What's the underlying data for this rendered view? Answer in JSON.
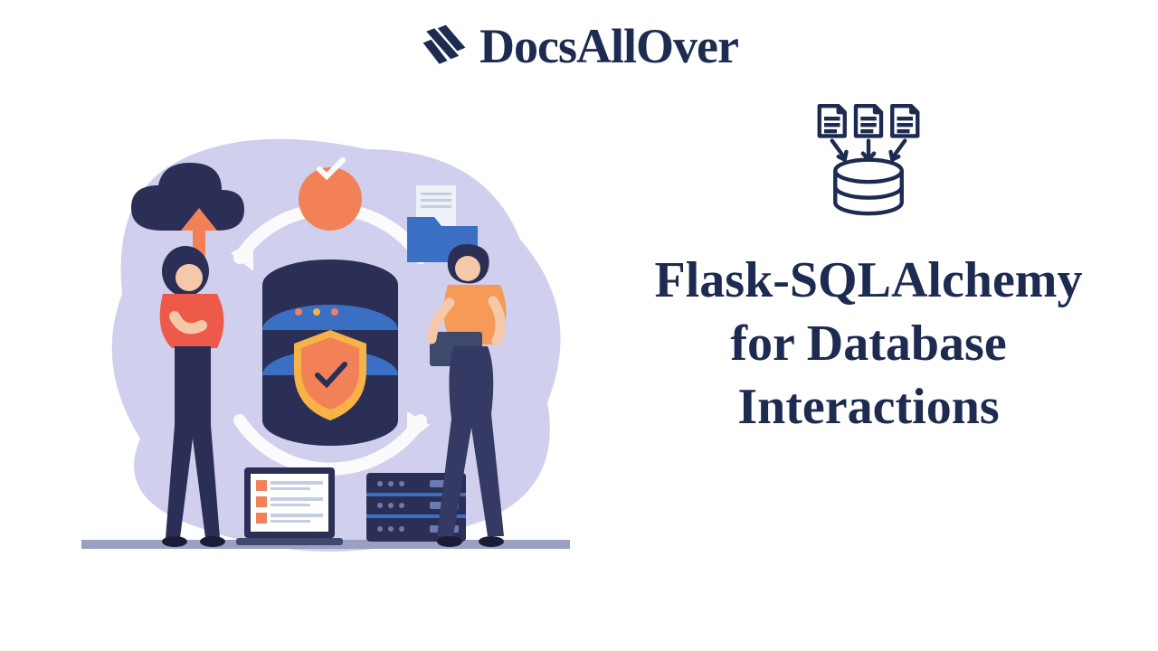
{
  "brand": {
    "name": "DocsAllOver"
  },
  "article": {
    "title": "Flask-SQLAlchemy for Database Interactions"
  },
  "colors": {
    "primary": "#1d2b50",
    "accent_orange": "#f28157",
    "accent_red": "#ee5a4a",
    "lavender": "#d0cfee",
    "slate": "#3e4a6b",
    "blue": "#3b6fc4",
    "yellow": "#f7b345"
  }
}
